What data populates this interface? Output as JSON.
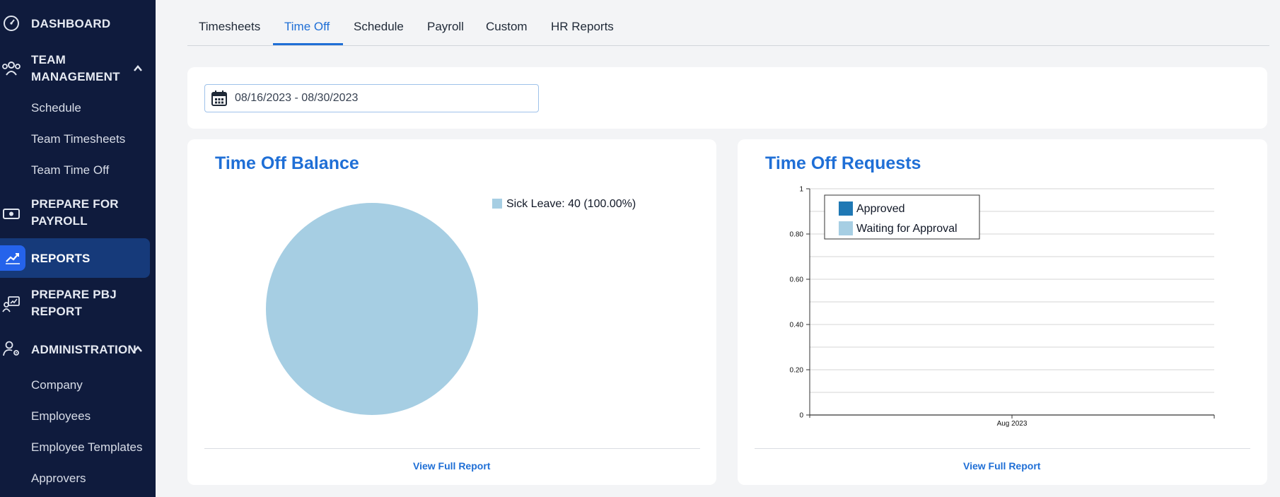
{
  "sidebar": {
    "items": [
      {
        "label": "DASHBOARD",
        "icon": "gauge-icon"
      },
      {
        "label": "TEAM MANAGEMENT",
        "icon": "team-icon",
        "expanded": true,
        "children": [
          "Schedule",
          "Team Timesheets",
          "Team Time Off"
        ]
      },
      {
        "label": "PREPARE FOR PAYROLL",
        "icon": "money-icon"
      },
      {
        "label": "REPORTS",
        "icon": "chart-line-icon",
        "active": true
      },
      {
        "label": "PREPARE PBJ REPORT",
        "icon": "report-icon"
      },
      {
        "label": "ADMINISTRATION",
        "icon": "user-gear-icon",
        "expanded": true,
        "children": [
          "Company",
          "Employees",
          "Employee Templates",
          "Approvers"
        ]
      }
    ]
  },
  "tabs": [
    {
      "label": "Timesheets"
    },
    {
      "label": "Time Off",
      "active": true
    },
    {
      "label": "Schedule"
    },
    {
      "label": "Payroll"
    },
    {
      "label": "Custom"
    },
    {
      "label": "HR Reports"
    }
  ],
  "filter": {
    "date_range": "08/16/2023 - 08/30/2023"
  },
  "balance_card": {
    "title": "Time Off Balance",
    "link": "View Full Report"
  },
  "requests_card": {
    "title": "Time Off Requests",
    "link": "View Full Report"
  },
  "chart_data": [
    {
      "type": "pie",
      "title": "Time Off Balance",
      "slices": [
        {
          "label": "Sick Leave",
          "value": 40,
          "percent": "100.00%",
          "color": "#a6cee3"
        }
      ],
      "legend_entries": [
        "Sick Leave: 40 (100.00%)"
      ],
      "legend": "right"
    },
    {
      "type": "bar",
      "title": "Time Off Requests",
      "categories": [
        "Aug 2023"
      ],
      "series": [
        {
          "name": "Approved",
          "values": [
            0
          ],
          "color": "#1f78b4"
        },
        {
          "name": "Waiting for Approval",
          "values": [
            0
          ],
          "color": "#a6cee3"
        }
      ],
      "ylim": [
        0,
        1
      ],
      "yticks": [
        "0",
        "0.20",
        "0.40",
        "0.60",
        "0.80",
        "1"
      ],
      "grid": true,
      "legend": "top-left"
    }
  ]
}
